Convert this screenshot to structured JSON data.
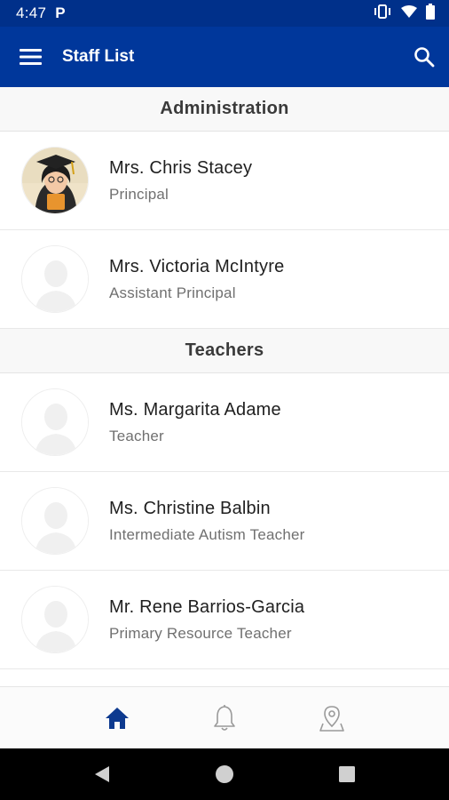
{
  "status_bar": {
    "time": "4:47",
    "carrier_icon": "P"
  },
  "app_bar": {
    "title": "Staff List",
    "menu_icon": "menu-icon",
    "search_icon": "search-icon"
  },
  "sections": [
    {
      "title": "Administration",
      "staff": [
        {
          "name": "Mrs. Chris Stacey",
          "role": "Principal",
          "avatar": "photo"
        },
        {
          "name": "Mrs. Victoria McIntyre",
          "role": "Assistant Principal",
          "avatar": "placeholder"
        }
      ]
    },
    {
      "title": "Teachers",
      "staff": [
        {
          "name": "Ms. Margarita Adame",
          "role": "Teacher",
          "avatar": "placeholder"
        },
        {
          "name": "Ms. Christine Balbin",
          "role": "Intermediate Autism Teacher",
          "avatar": "placeholder"
        },
        {
          "name": "Mr. Rene Barrios-Garcia",
          "role": "Primary Resource Teacher",
          "avatar": "placeholder"
        }
      ]
    }
  ],
  "bottom_nav": {
    "items": [
      "home-icon",
      "bell-icon",
      "map-pin-icon"
    ],
    "active": "home-icon"
  },
  "colors": {
    "app_bar": "#00379b",
    "status_bar": "#00308a",
    "active_nav": "#0d3a8f",
    "inactive_nav": "#9a9a9a"
  }
}
